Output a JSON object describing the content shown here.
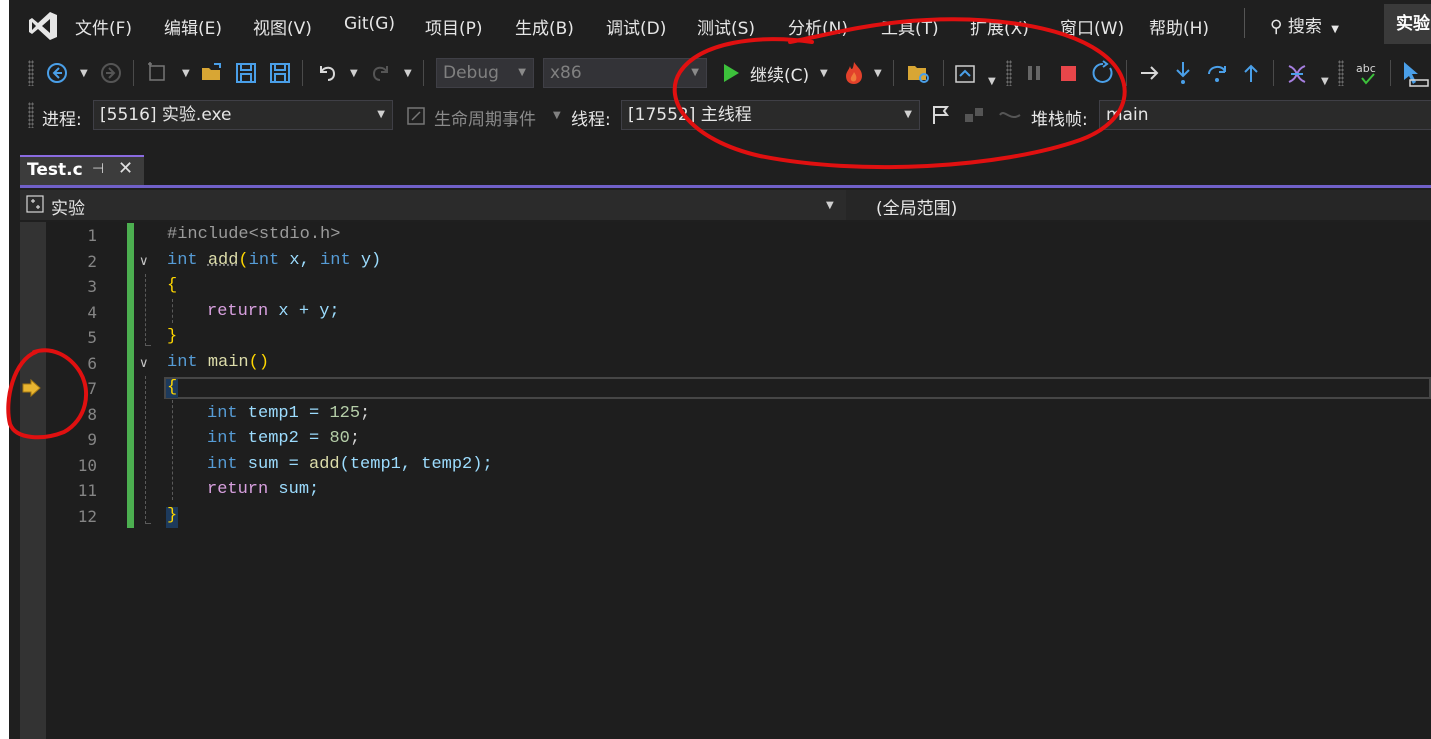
{
  "menu": {
    "items": [
      "文件(F)",
      "编辑(E)",
      "视图(V)",
      "Git(G)",
      "项目(P)",
      "生成(B)",
      "调试(D)",
      "测试(S)",
      "分析(N)",
      "工具(T)",
      "扩展(X)",
      "窗口(W)",
      "帮助(H)"
    ],
    "search_label": "搜索",
    "solution_name": "实验"
  },
  "toolbar": {
    "config": "Debug",
    "platform": "x86",
    "continue_label": "继续(C)"
  },
  "debug_location": {
    "process_label": "进程:",
    "process_value": "[5516] 实验.exe",
    "lifecycle_label": "生命周期事件",
    "thread_label": "线程:",
    "thread_value": "[17552] 主线程",
    "stackframe_label": "堆栈帧:",
    "stackframe_value": "main"
  },
  "tab": {
    "title": "Test.c"
  },
  "navbar": {
    "project": "实验",
    "scope": "(全局范围)"
  },
  "editor": {
    "line_numbers": [
      "1",
      "2",
      "3",
      "4",
      "5",
      "6",
      "7",
      "8",
      "9",
      "10",
      "11",
      "12"
    ],
    "current_line": 7,
    "colors": {
      "keyword": "#569cd6",
      "function": "#dcdcaa",
      "number": "#b5cea8",
      "bracket": "#ffd700",
      "change_bar": "#4caf50"
    },
    "tokens": {
      "l1": "#include<stdio.h>",
      "l2_kw": "int",
      "l2_fn": "add",
      "l2_rest_a": "(",
      "l2_kw2": "int",
      "l2_rest_b": " x, ",
      "l2_kw3": "int",
      "l2_rest_c": " y)",
      "l3": "{",
      "l4_kw": "return",
      "l4_rest": " x + y;",
      "l5": "}",
      "l6_kw": "int",
      "l6_fn": "main",
      "l6_rest": "()",
      "l7": "{",
      "l8_kw": "int",
      "l8_var": " temp1 = ",
      "l8_num": "125",
      "l8_end": ";",
      "l9_kw": "int",
      "l9_var": " temp2 = ",
      "l9_num": "80",
      "l9_end": ";",
      "l10_kw": "int",
      "l10_var": " sum = ",
      "l10_fn": "add",
      "l10_rest": "(temp1, temp2);",
      "l11_kw": "return",
      "l11_rest": " sum;",
      "l12": "}"
    }
  },
  "annotations": {
    "stroke_color": "#e01010"
  }
}
